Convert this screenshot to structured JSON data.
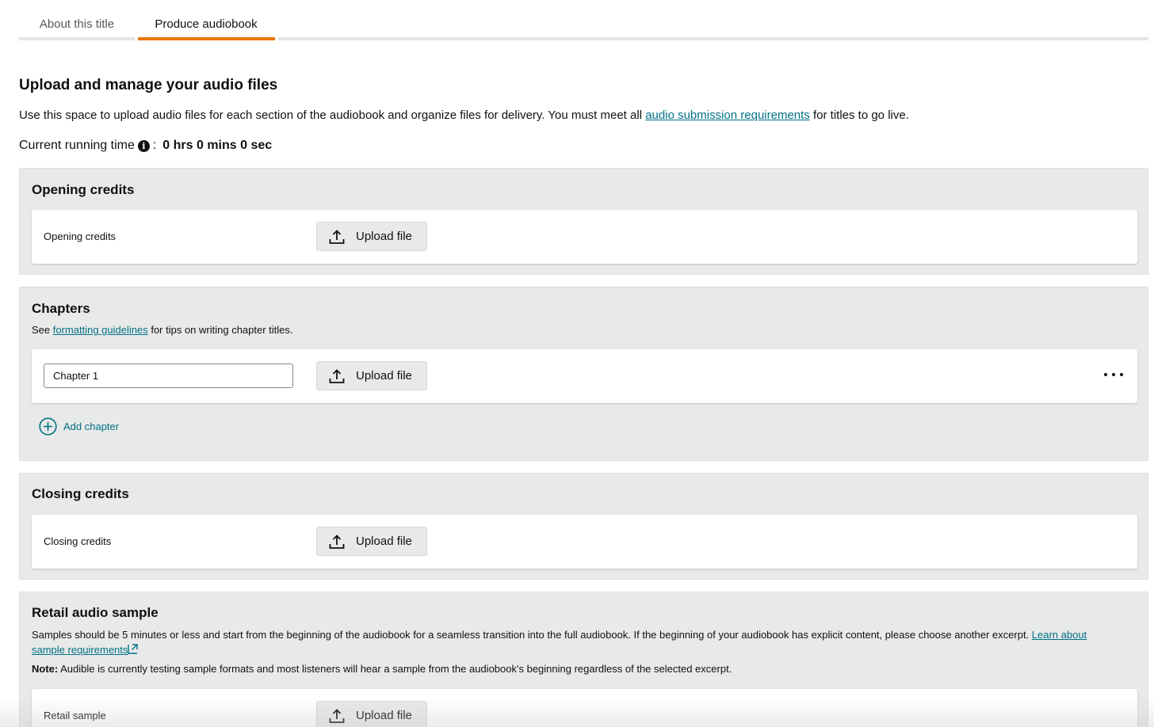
{
  "tabs": [
    "About this title",
    "Produce audiobook"
  ],
  "page": {
    "title": "Upload and manage your audio files",
    "intro_before": "Use this space to upload audio files for each section of the audiobook and organize files for delivery. You must meet all ",
    "intro_link": "audio submission requirements",
    "intro_after": " for titles to go live.",
    "runtime_label": "Current running time",
    "runtime_colon": ":",
    "runtime_value": "0 hrs 0 mins 0 sec"
  },
  "upload_label": "Upload file",
  "opening": {
    "heading": "Opening credits",
    "row_label": "Opening credits"
  },
  "chapters": {
    "heading": "Chapters",
    "desc_before": "See ",
    "desc_link": "formatting guidelines",
    "desc_after": " for tips on writing chapter titles.",
    "chapter_value": "Chapter 1",
    "add_label": "Add chapter"
  },
  "closing": {
    "heading": "Closing credits",
    "row_label": "Closing credits"
  },
  "retail": {
    "heading": "Retail audio sample",
    "desc": "Samples should be 5 minutes or less and start from the beginning of the audiobook for a seamless transition into the full audiobook. If the beginning of your audiobook has explicit content, please choose another excerpt. ",
    "desc_link_line1": "Learn about",
    "desc_link_line2": "sample requirements",
    "note_label": "Note:",
    "note_text": " Audible is currently testing sample formats and most listeners will hear a sample from the audiobook's beginning regardless of the selected excerpt.",
    "row_label": "Retail sample"
  },
  "icons": {
    "upload": "upload-icon",
    "info": "info-icon",
    "add": "plus-circle-icon",
    "external": "external-link-icon",
    "more": "more-horizontal-icon"
  },
  "colors": {
    "accent_tab": "#e77600",
    "link": "#007185",
    "section_bg": "#e8e9e9"
  }
}
